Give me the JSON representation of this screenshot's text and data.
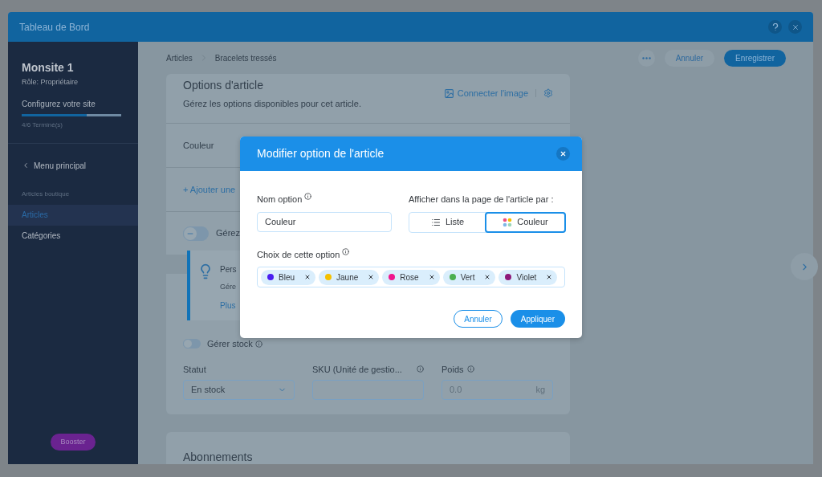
{
  "window": {
    "title": "Tableau de Bord"
  },
  "sidebar": {
    "site_name": "Monsite 1",
    "role": "Rôle: Propriétaire",
    "setup": {
      "label": "Configurez votre site",
      "level": 0.65,
      "status": "4/6 Terminé(s)"
    },
    "back": "Menu principal",
    "section": "Articles boutique",
    "items": [
      {
        "label": "Articles",
        "selected": true
      },
      {
        "label": "Catégories",
        "selected": false
      }
    ],
    "booster": "Booster"
  },
  "header": {
    "breadcrumb": [
      "Articles",
      "Bracelets tressés"
    ],
    "cancel": "Annuler",
    "save": "Enregistrer"
  },
  "options_card": {
    "title": "Options d'article",
    "subtitle": "Gérez les options disponibles pour cet article.",
    "connect_image": "Connecter l'image",
    "option_rows": [
      "Couleur"
    ],
    "add_option": "+ Ajouter une",
    "manage_variants": {
      "label": "Gérez",
      "on": false
    }
  },
  "tip": {
    "title": "Pers",
    "text": "Gére",
    "link": "Plus"
  },
  "inventory_card": {
    "manage_stock": {
      "label": "Gérer stock",
      "on": false
    },
    "fields": [
      {
        "kind": "select",
        "label": "Statut",
        "value": "En stock"
      },
      {
        "kind": "text",
        "label": "SKU (Unité de gestio..."
      },
      {
        "kind": "unit",
        "label": "Poids",
        "placeholder": "0.0",
        "unit": "kg"
      }
    ]
  },
  "subscriptions_card": {
    "title": "Abonnements"
  },
  "dialog": {
    "title": "Modifier option de l'article",
    "name_label": "Nom option",
    "name_value": "Couleur",
    "display_label": "Afficher dans la page de l'article par :",
    "display_options": [
      {
        "kind": "list",
        "label": "Liste",
        "selected": false
      },
      {
        "kind": "color",
        "label": "Couleur",
        "selected": true
      }
    ],
    "choices_label": "Choix de cette option",
    "choices": [
      {
        "label": "Bleu",
        "color": "#4a1ff0"
      },
      {
        "label": "Jaune",
        "color": "#f5c000"
      },
      {
        "label": "Rose",
        "color": "#f0168e"
      },
      {
        "label": "Vert",
        "color": "#4caf50"
      },
      {
        "label": "Violet",
        "color": "#8e1a7a"
      }
    ],
    "cancel": "Annuler",
    "apply": "Appliquer"
  }
}
